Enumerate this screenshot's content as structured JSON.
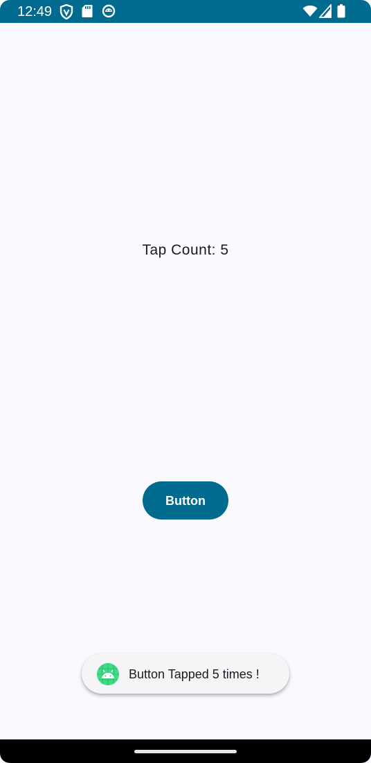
{
  "status_bar": {
    "time": "12:49",
    "icons": [
      "vpn-shield-icon",
      "sd-card-icon",
      "android-debug-icon",
      "wifi-icon",
      "cellular-signal-icon",
      "battery-icon"
    ],
    "background_color": "#006a8f"
  },
  "main": {
    "tap_count_text": "Tap Count: 5",
    "button_label": "Button",
    "accent_color": "#006a8f"
  },
  "toast": {
    "icon": "android-app-icon",
    "message": "Button Tapped 5 times !"
  },
  "navigation": {
    "gesture_handle": "home-gesture-handle"
  }
}
